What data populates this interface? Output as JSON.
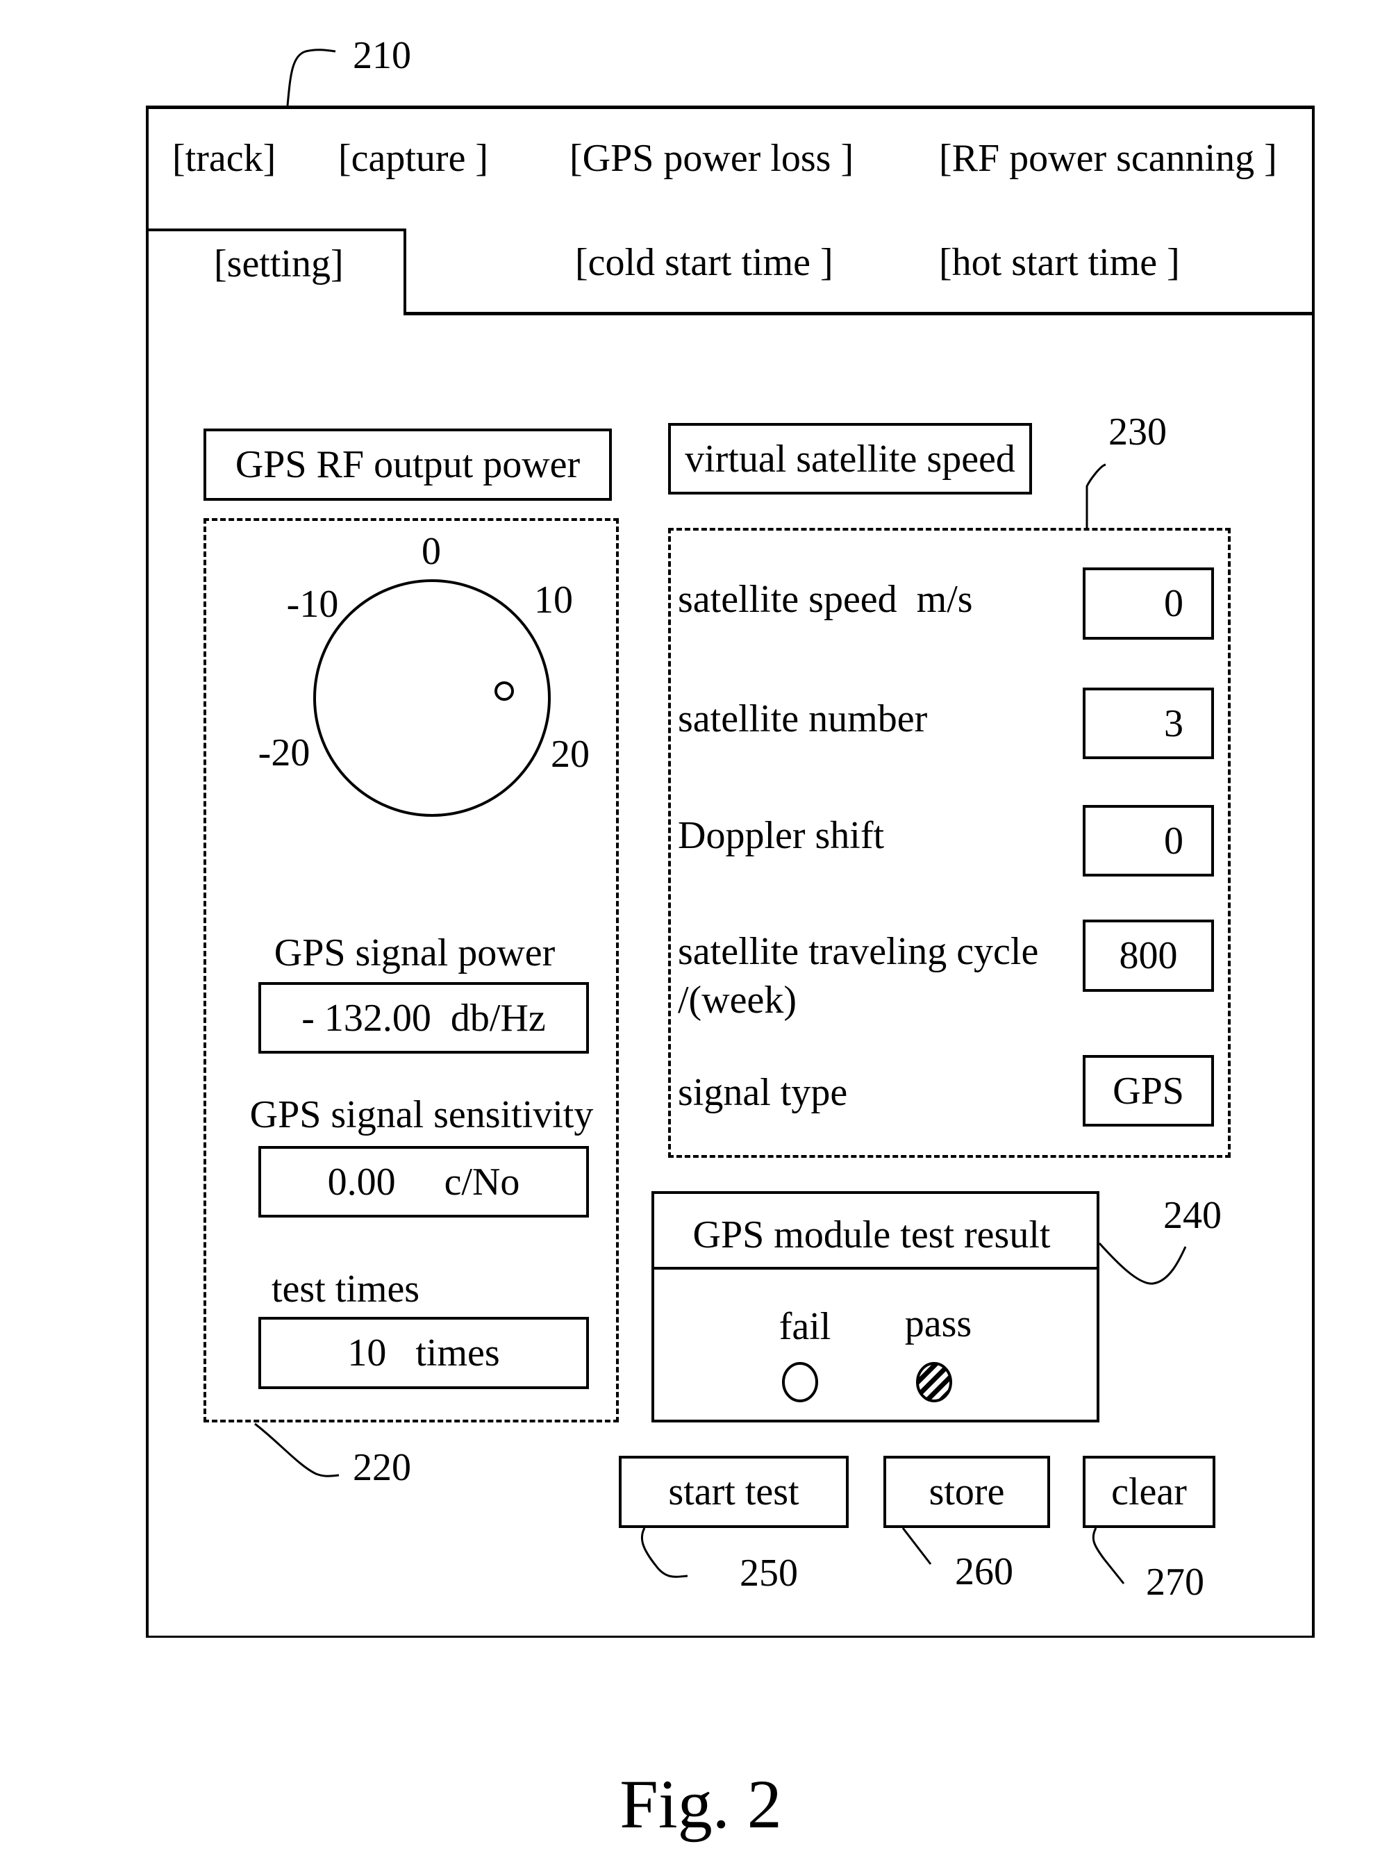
{
  "reference_labels": {
    "tab_area": "210",
    "power_panel": "220",
    "satellite_panel": "230",
    "result_panel": "240",
    "start_button": "250",
    "store_button": "260",
    "clear_button": "270"
  },
  "tabs": {
    "row1": [
      "[track]",
      "[capture ]",
      "[GPS power loss ]",
      "[RF power scanning ]"
    ],
    "row2": [
      "[setting]",
      "[cold start time ]",
      "[hot start time ]"
    ],
    "active": "[setting]"
  },
  "power_panel": {
    "title": "GPS RF output power",
    "dial": {
      "tick_labels": [
        "0",
        "-10",
        "10",
        "-20",
        "20"
      ],
      "min": -20,
      "max": 20
    },
    "signal_power_label": "GPS signal power",
    "signal_power_value": "- 132.00  db/Hz",
    "sensitivity_label": "GPS signal sensitivity",
    "sensitivity_value": "0.00     c/No",
    "test_times_label": "test times",
    "test_times_value": "10   times"
  },
  "satellite_panel": {
    "title": "virtual satellite speed",
    "rows": [
      {
        "label": "satellite speed  m/s",
        "value": "0"
      },
      {
        "label": "satellite number",
        "value": "3"
      },
      {
        "label": "Doppler shift",
        "value": "0"
      },
      {
        "label": "satellite traveling cycle",
        "label2": "/(week)",
        "value": "800"
      },
      {
        "label": "signal type",
        "value": "GPS"
      }
    ]
  },
  "result_panel": {
    "title": "GPS module test result",
    "fail_label": "fail",
    "pass_label": "pass",
    "selected": "pass"
  },
  "buttons": {
    "start": "start test",
    "store": "store",
    "clear": "clear"
  },
  "caption": "Fig. 2"
}
